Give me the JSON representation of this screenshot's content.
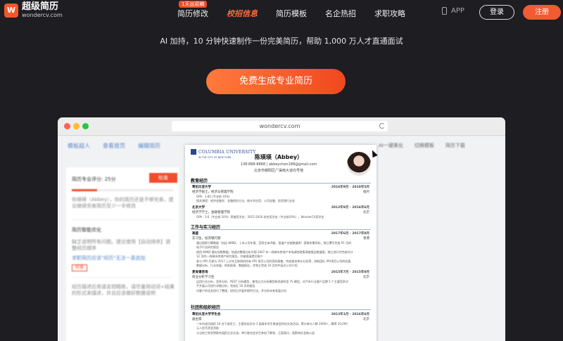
{
  "header": {
    "logo_title": "超级简历",
    "logo_sub": "wondercv.com",
    "logo_mark": "W",
    "nav": [
      {
        "label": "简历修改",
        "badge": "1天出初稿",
        "active": false
      },
      {
        "label": "校招信息",
        "active": true
      },
      {
        "label": "简历模板",
        "active": false
      },
      {
        "label": "名企热招",
        "active": false
      },
      {
        "label": "求职攻略",
        "active": false
      }
    ],
    "app_label": "APP",
    "login_label": "登录",
    "register_label": "注册"
  },
  "hero": {
    "tagline": "AI 加持，10 分钟快速制作一份完美简历，帮助 1,000 万人才直通面试",
    "cta_label": "免费生成专业简历"
  },
  "browser": {
    "url": "wondercv.com"
  },
  "editor": {
    "tabs": [
      "模板超人",
      "查看首页",
      "编辑简历"
    ],
    "tools": [
      "AI一键美化",
      "切换模板",
      "简历下载"
    ],
    "score_label": "简历专业评分: 25分",
    "score_button": "检查",
    "score_fraction": 0.25,
    "score_desc": "你瑛瑛（Abbey），你的简历还是不够完善，建议继续完善简历至少一半修改",
    "tips_title": "简历智能优化",
    "tip1": "缺乏说明所有问题。建议使用【自动排序】调整经历顺序",
    "tip1_link": "求职简历应该\"经历\"无法一直追加",
    "tip1_tag": "检查",
    "tip2": "经历描述应用语言短精练，请尽量用动词+结果的形式来描述，并且应该做好数据说明"
  },
  "resume": {
    "univ_name": "COLUMBIA UNIVERSITY",
    "univ_sub": "IN THE CITY OF NEW YORK",
    "name": "陈瑛瑛（Abbey）",
    "contact": "138-888-8888 | abbeychen188@gmail.com",
    "address": "北京市朝阳区广渠南大道均号馆",
    "sections": {
      "education": "教育经历",
      "work": "工作与实习经历",
      "campus": "社团和组织经历"
    },
    "edu": [
      {
        "school": "哥伦比亚大学",
        "date": "2016年9月 - 2018年5月",
        "major": "经济学硕士，经济与管理学院",
        "loc": "纽约",
        "bullets": [
          "GPA：3.85 (专业前 10%)",
          "相关课程：经济金融学、金融研究方法、统计学应用、公司金融、投资银行业务"
        ]
      },
      {
        "school": "北京大学",
        "date": "2012年9月 - 2016年6月",
        "major": "经济学学士，金融管理学院",
        "loc": "北京",
        "bullets": [
          "GPA：3.6（专业前 10%）荣誉奖学金：2015-2016 综合奖学金（专业前10%），WonderCV奖学金"
        ]
      }
    ],
    "work": [
      {
        "company": "高盛",
        "date": "2017年6月 - 2017年8月",
        "role": "实习生，投资银行部",
        "loc": "香港",
        "bullets": [
          "通过搜索引擎数据（包括 WIND、上市公司年报、官网主体评级、报道产业链数据库）获取所需资料，独立撰写完成 91 页的",
          "电子行业研究报告",
          "使用 WIND 量化导数数据，快速对整理分析中国 2007 年一线城市房地产市场调控政策调查报告数据图，独立进行并完成共计",
          "12 页的一线城市房地产研究报告，并被直接提交客户",
          "参与 IPO 尽调与 2017 上半年互联网的所有 IPO 项目公司的资料搜集，完成相关审计分析等，协助团队 IPO项目公司的估值",
          "数据分析、行业发展、财务报表、数据报告，并独立完成 10 页的中英文公司介绍"
        ]
      },
      {
        "company": "麦肯锡咨询",
        "date": "2015年7月 - 2015年9月",
        "role": "商业分析学习生",
        "loc": "北京",
        "bullets": [
          "运用行业分析、竞争分析、PEST 分析模型、使用五力分析模型和资源利用 7S 模型。对汽车行业客户品牌 5 个主要竞争对",
          "手开展公司进行详细分析，完成近 50 页的报告",
          "对客户的业务进行了整理，研究后开展并提供方法，并分析未来发展方向"
        ]
      }
    ],
    "campus": [
      {
        "org": "哥伦比亚大学学生会",
        "date": "2013年1月 - 2016年6月",
        "role": "副主席",
        "loc": "北京",
        "bullets": [
          "一年内成功组织 16 名干部员工，主要包括学办 3 届青年学生联谊会科技交流活动，累计参与人数 2000+，募得 20,000",
          "元人民币资金资助",
          "与当地工程学院联合组织企业交流，举行联合会学生参加了解答、正面观点，面影响社会新公益"
        ]
      }
    ]
  }
}
